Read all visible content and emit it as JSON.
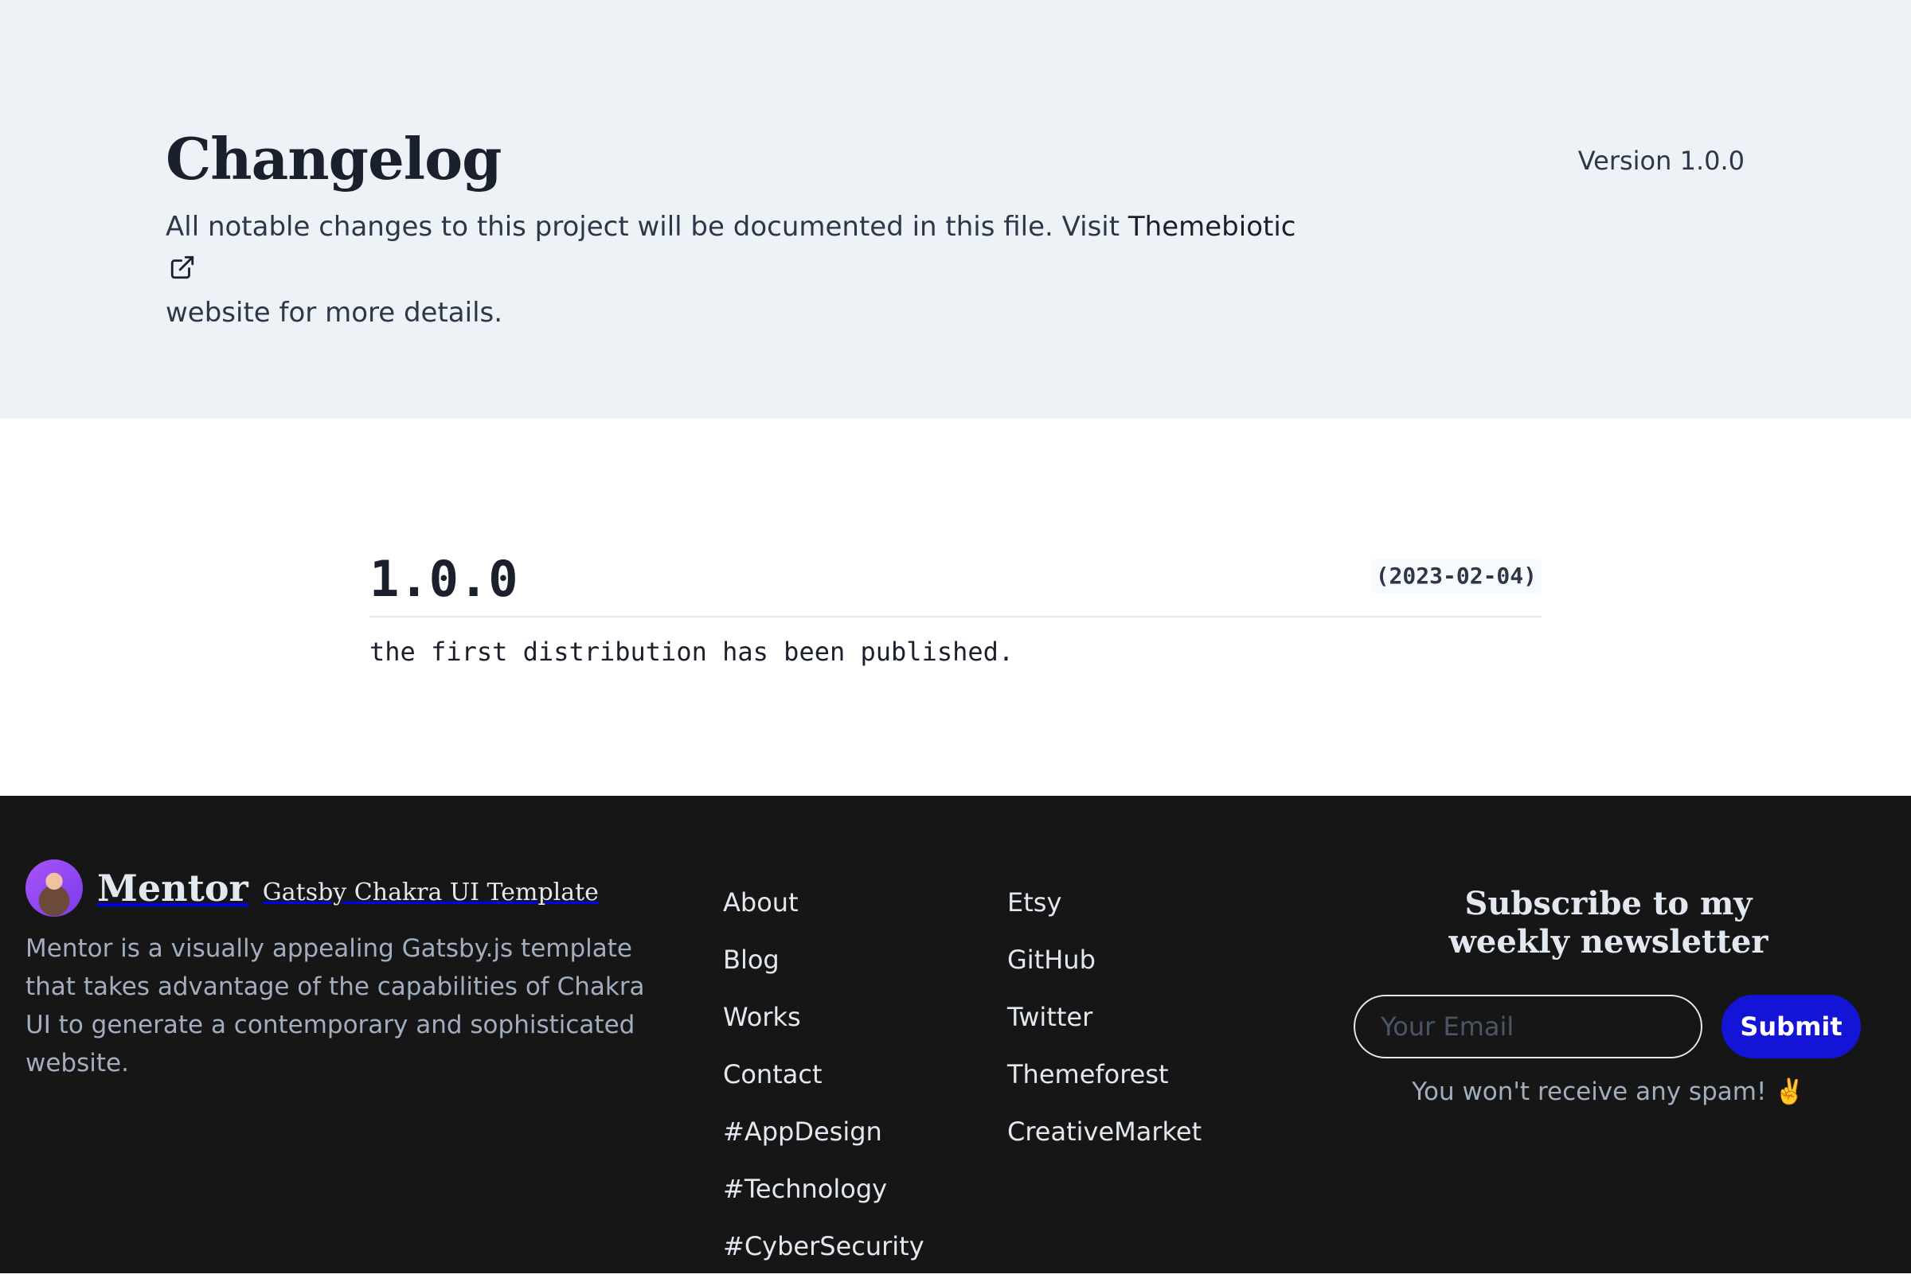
{
  "hero": {
    "title": "Changelog",
    "description_prefix": "All notable changes to this project will be documented in this file. Visit ",
    "link_text": "Themebiotic",
    "description_suffix": "website for more details.",
    "version": "Version 1.0.0",
    "link_icon": "external-link-icon"
  },
  "entry": {
    "version": "1.0.0",
    "date": "(2023-02-04)",
    "body": "the first distribution has been published."
  },
  "footer": {
    "brand": {
      "name": "Mentor",
      "tagline": "Gatsby Chakra UI Template",
      "description": "Mentor is a visually appealing Gatsby.js template that takes advantage of the capabilities of Chakra UI to generate a contemporary and sophisticated website."
    },
    "links_primary": [
      "About",
      "Blog",
      "Works",
      "Contact",
      "#AppDesign",
      "#Technology",
      "#CyberSecurity"
    ],
    "links_secondary": [
      "Etsy",
      "GitHub",
      "Twitter",
      "Themeforest",
      "CreativeMarket"
    ],
    "newsletter": {
      "title": "Subscribe to my weekly newsletter",
      "placeholder": "Your Email",
      "submit_label": "Submit",
      "note": "You won't receive any spam! ✌️"
    }
  },
  "colors": {
    "hero_bg": "#edf2f7",
    "footer_bg": "#161616",
    "accent": "#1414d6"
  }
}
